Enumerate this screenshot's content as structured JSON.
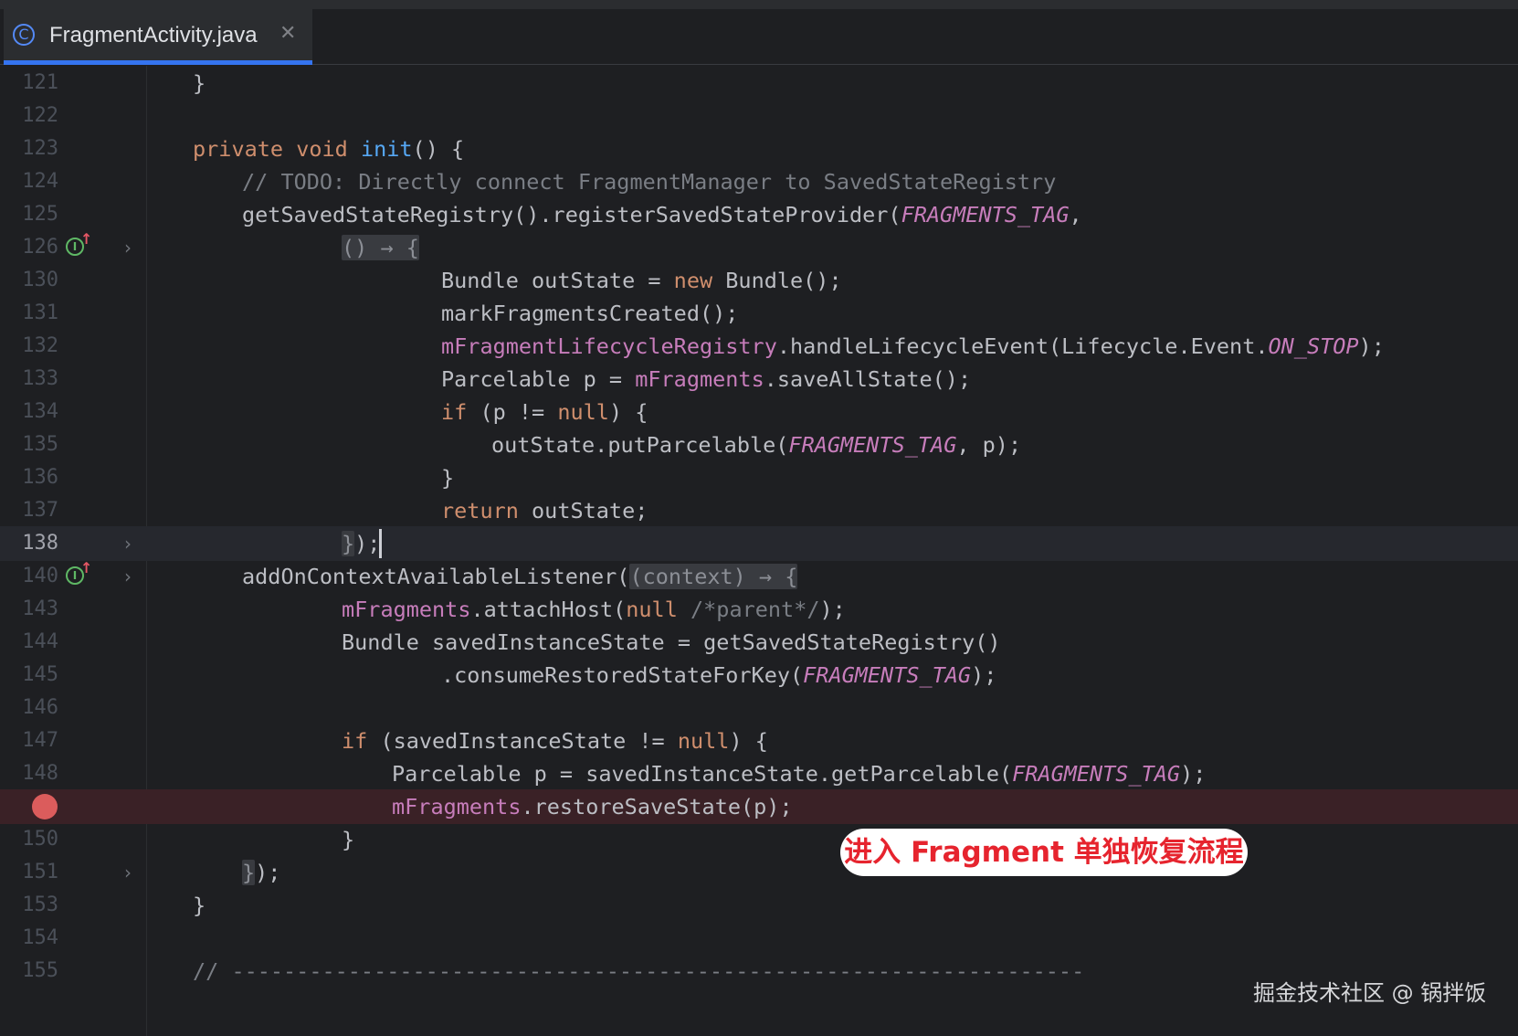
{
  "tab": {
    "icon": "java-class-icon",
    "icon_glyph": "C",
    "title": "FragmentActivity.java",
    "close_glyph": "✕"
  },
  "gutter": {
    "implements_glyph": "I",
    "implements_arrow": "↑",
    "fold_glyph": "›"
  },
  "lines": [
    {
      "n": "121"
    },
    {
      "n": "122"
    },
    {
      "n": "123"
    },
    {
      "n": "124"
    },
    {
      "n": "125"
    },
    {
      "n": "126"
    },
    {
      "n": "130"
    },
    {
      "n": "131"
    },
    {
      "n": "132"
    },
    {
      "n": "133"
    },
    {
      "n": "134"
    },
    {
      "n": "135"
    },
    {
      "n": "136"
    },
    {
      "n": "137"
    },
    {
      "n": "138"
    },
    {
      "n": "140"
    },
    {
      "n": "143"
    },
    {
      "n": "144"
    },
    {
      "n": "145"
    },
    {
      "n": "146"
    },
    {
      "n": "147"
    },
    {
      "n": "148"
    },
    {
      "n": ""
    },
    {
      "n": "150"
    },
    {
      "n": "151"
    },
    {
      "n": "153"
    },
    {
      "n": "154"
    },
    {
      "n": "155"
    }
  ],
  "code": {
    "l121": {
      "t1": "}"
    },
    "l123": {
      "t1": "private",
      "t2": " ",
      "t3": "void",
      "t4": " ",
      "t5": "init",
      "t6": "() {"
    },
    "l124": {
      "t1": "// TODO: Directly connect FragmentManager to SavedStateRegistry"
    },
    "l125": {
      "t1": "getSavedStateRegistry().registerSavedStateProvider(",
      "t2": "FRAGMENTS_TAG",
      "t3": ","
    },
    "l126": {
      "t1": "() → {"
    },
    "l130": {
      "t1": "Bundle outState = ",
      "t2": "new",
      "t3": " Bundle();"
    },
    "l131": {
      "t1": "markFragmentsCreated();"
    },
    "l132": {
      "t1": "mFragmentLifecycleRegistry",
      "t2": ".handleLifecycleEvent(Lifecycle.Event.",
      "t3": "ON_STOP",
      "t4": ");"
    },
    "l133": {
      "t1": "Parcelable p = ",
      "t2": "mFragments",
      "t3": ".saveAllState();"
    },
    "l134": {
      "t1": "if",
      "t2": " (p != ",
      "t3": "null",
      "t4": ") {"
    },
    "l135": {
      "t1": "outState.putParcelable(",
      "t2": "FRAGMENTS_TAG",
      "t3": ", p);"
    },
    "l136": {
      "t1": "}"
    },
    "l137": {
      "t1": "return",
      "t2": " outState;"
    },
    "l138": {
      "t1": "}",
      "t2": ");"
    },
    "l140": {
      "t1": "addOnContextAvailableListener(",
      "t2": "(context) → {"
    },
    "l143": {
      "t1": "mFragments",
      "t2": ".attachHost(",
      "t3": "null",
      "t4": " ",
      "t5": "/*parent*/",
      "t6": ");"
    },
    "l144": {
      "t1": "Bundle savedInstanceState = getSavedStateRegistry()"
    },
    "l145": {
      "t1": ".consumeRestoredStateForKey(",
      "t2": "FRAGMENTS_TAG",
      "t3": ");"
    },
    "l147": {
      "t1": "if",
      "t2": " (savedInstanceState != ",
      "t3": "null",
      "t4": ") {"
    },
    "l148": {
      "t1": "Parcelable p = savedInstanceState.getParcelable(",
      "t2": "FRAGMENTS_TAG",
      "t3": ");"
    },
    "l149": {
      "t1": "mFragments",
      "t2": ".restoreSaveState(p);"
    },
    "l150": {
      "t1": "}"
    },
    "l151": {
      "t1": "}",
      "t2": ");"
    },
    "l153": {
      "t1": "}"
    },
    "l155": {
      "t1": "// ------------------------------------------------------------------"
    }
  },
  "annotation": "进入 Fragment 单独恢复流程",
  "watermark": "掘金技术社区 @ 锅拌饭",
  "colors": {
    "background": "#1e1f22",
    "keyword": "#cf8e6d",
    "method": "#56a8f5",
    "field": "#c77dbb",
    "comment": "#7a7e85",
    "text": "#bcbec4",
    "breakpoint": "#db5c5c",
    "tab_underline": "#3574f0",
    "annotation_text": "#e6242e"
  }
}
